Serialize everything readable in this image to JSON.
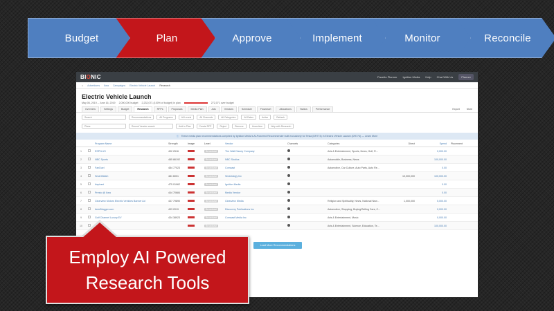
{
  "process": {
    "steps": [
      "Budget",
      "Plan",
      "Approve",
      "Implement",
      "Monitor",
      "Reconcile"
    ],
    "active_step": "Plan",
    "colors": {
      "step": "#4f7fc0",
      "active": "#c3161b"
    }
  },
  "app": {
    "logo": {
      "prefix": "BI",
      "o": "O",
      "suffix": "NIC"
    },
    "top_right": [
      "Pacetto Planner",
      "Ignition Media",
      "Help",
      "Chat With Us",
      "Planner"
    ],
    "breadcrumbs": [
      "Advertisers",
      "Ikea",
      "Campaigns",
      "Electric Vehicle Launch",
      "Research"
    ],
    "page_title": "Electric Vehicle Launch",
    "subline": {
      "dates": "May 06, 2019 – June 16, 2019",
      "budget": "2,000,000 budget",
      "plan": "2,232,071 (100% of budget) in plan",
      "over": "272,071 over budget"
    },
    "tabs": [
      "Overview",
      "Settings",
      "Budget",
      "Research",
      "RFPs",
      "Proposals",
      "Media Plan",
      "Ads",
      "Vendors",
      "Schedule",
      "Flowchart",
      "Allocations",
      "Tactics",
      "Performance"
    ],
    "active_tab": "Research",
    "tab_actions": [
      "Export",
      "More"
    ],
    "filters_row1": [
      "Search",
      "Recommendations",
      "All Programs",
      "All Levels",
      "All Channels",
      "All Categories",
      "All Dates",
      "Active",
      "Refresh"
    ],
    "filters_row2": [
      "Plans",
      "Recent Vendor search",
      "Add to Plan",
      "Create RFP",
      "Reject",
      "Remove",
      "Unarchive",
      "Help with Research"
    ],
    "info_text": "These media plan recommendations compiled by Ignition Media's AI-Powered Recommender built exclusively for Tesla (DR774) in Electric Vehicle Launch (DR774) — Learn More",
    "columns": [
      "",
      "",
      "Program Name",
      "Strength",
      "Image",
      "Level",
      "Vendor",
      "Channels",
      "Categories",
      "Direct",
      "Spend",
      "Placement"
    ],
    "rows": [
      {
        "idx": "1",
        "name": "ESPN US",
        "strength": "492 2516",
        "level": "Broadcast",
        "vendor": "The Walt Disney Company",
        "category": "Arts & Entertainment, Sports, News, Golf, R...",
        "direct": "",
        "spent": "0,000.00"
      },
      {
        "idx": "2",
        "name": "NBC Sports",
        "strength": "485 86192",
        "level": "Broadcast",
        "vendor": "NBC Studios",
        "category": "Automobile, Business, News",
        "direct": "",
        "spent": "100,000.00"
      },
      {
        "idx": "3",
        "name": "FanDuel",
        "strength": "484 77023",
        "level": "Broadcast",
        "vendor": "Comcast",
        "category": "Automotive, Car Culture, Auto Parts, Auto Re...",
        "direct": "",
        "spent": "0.00"
      },
      {
        "idx": "4",
        "name": "SmartMatch",
        "strength": "481 6001",
        "level": "Broadcast",
        "vendor": "Smartology Inc",
        "category": "",
        "direct": "10,000,000",
        "spent": "100,000.00"
      },
      {
        "idx": "5",
        "name": "Aspirant",
        "strength": "475 01962",
        "level": "Broadcast",
        "vendor": "Ignition Media",
        "category": "",
        "direct": "",
        "spent": "0.00"
      },
      {
        "idx": "6",
        "name": "Presto @ Ikea",
        "strength": "444 70684",
        "level": "Broadcast",
        "vendor": "Media Vendor",
        "category": "",
        "direct": "",
        "spent": "0.00"
      },
      {
        "idx": "7",
        "name": "Clearview Motors Electric Vehicles Banner Ad",
        "strength": "437 79890",
        "level": "Broadcast",
        "vendor": "Clearview Media",
        "category": "Religion and Spirituality, News, National New...",
        "direct": "1,000,000",
        "spent": "5,000.00"
      },
      {
        "idx": "8",
        "name": "AutoBlogger.com",
        "strength": "433 2019",
        "level": "Broadcast",
        "vendor": "Discovery Publications Inc",
        "category": "Automotive, Shopping, Buying/Selling Cars, C...",
        "direct": "",
        "spent": "0,000.00"
      },
      {
        "idx": "9",
        "name": "Golf Channel Luxury EV",
        "strength": "434 38923",
        "level": "Broadcast",
        "vendor": "Comcast Media Inc",
        "category": "Arts & Entertainment, Music",
        "direct": "",
        "spent": "0,000.00"
      },
      {
        "idx": "10",
        "name": "",
        "strength": "",
        "level": "Broadcast",
        "vendor": "",
        "category": "Arts & Entertainment, Science, Education, Te...",
        "direct": "",
        "spent": "100,000.00"
      }
    ],
    "load_more": "Load More Recommendations"
  },
  "callout": {
    "line1": "Employ AI Powered",
    "line2": "Research Tools"
  }
}
